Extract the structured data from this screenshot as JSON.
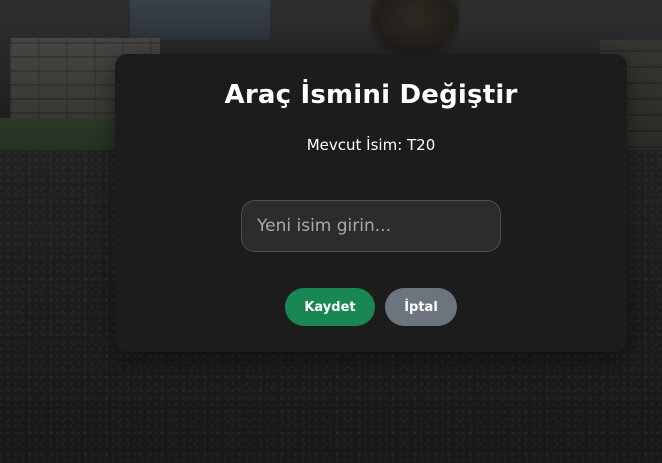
{
  "modal": {
    "title": "Araç İsmini Değiştir",
    "current_name": "Mevcut İsim: T20",
    "input": {
      "value": "",
      "placeholder": "Yeni isim girin..."
    },
    "save_label": "Kaydet",
    "cancel_label": "İptal"
  },
  "colors": {
    "modal_background": "#1c1c1c",
    "save_button": "#198754",
    "cancel_button": "#6c757d",
    "text": "#ffffff"
  }
}
